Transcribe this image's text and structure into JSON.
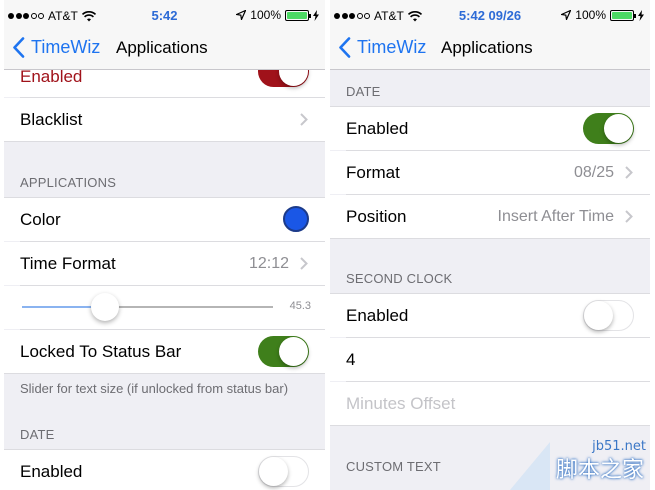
{
  "left": {
    "status": {
      "carrier": "AT&T",
      "time": "5:42",
      "battery": "100%"
    },
    "nav": {
      "back": "TimeWiz",
      "title": "Applications"
    },
    "rows": {
      "enabled_top": "Enabled",
      "blacklist": "Blacklist",
      "section_applications": "APPLICATIONS",
      "color": "Color",
      "time_format": "Time Format",
      "time_format_value": "12:12",
      "slider_value": "45.3",
      "slider_level": 0.33,
      "locked": "Locked To Status Bar",
      "footer": "Slider for text size (if unlocked from status bar)",
      "section_date": "DATE",
      "enabled_bottom": "Enabled"
    },
    "colors": {
      "swatch": "#1a57e6",
      "switch_on": "#3f7f1b",
      "switch_red": "#a0121a"
    }
  },
  "right": {
    "status": {
      "carrier": "AT&T",
      "time": "5:42 09/26",
      "battery": "100%"
    },
    "nav": {
      "back": "TimeWiz",
      "title": "Applications"
    },
    "rows": {
      "section_date": "DATE",
      "enabled": "Enabled",
      "format": "Format",
      "format_value": "08/25",
      "position": "Position",
      "position_value": "Insert After Time",
      "section_second_clock": "SECOND CLOCK",
      "second_enabled": "Enabled",
      "offset_value": "4",
      "offset_placeholder": "Minutes Offset",
      "section_custom_text": "CUSTOM TEXT"
    }
  },
  "watermark": {
    "site": "jb51.net",
    "name": "脚本之家"
  }
}
